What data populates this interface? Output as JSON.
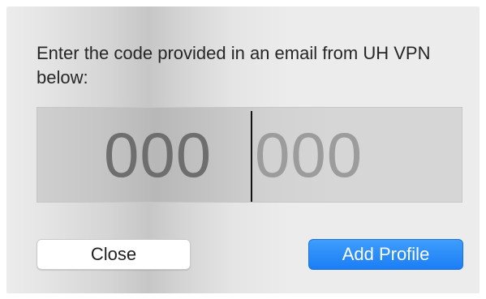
{
  "dialog": {
    "prompt": "Enter the code provided in an email from UH VPN below:",
    "code_field": {
      "first_half": "000",
      "second_half": "000"
    },
    "buttons": {
      "close_label": "Close",
      "add_profile_label": "Add Profile"
    }
  },
  "colors": {
    "accent": "#1b7ef5"
  }
}
